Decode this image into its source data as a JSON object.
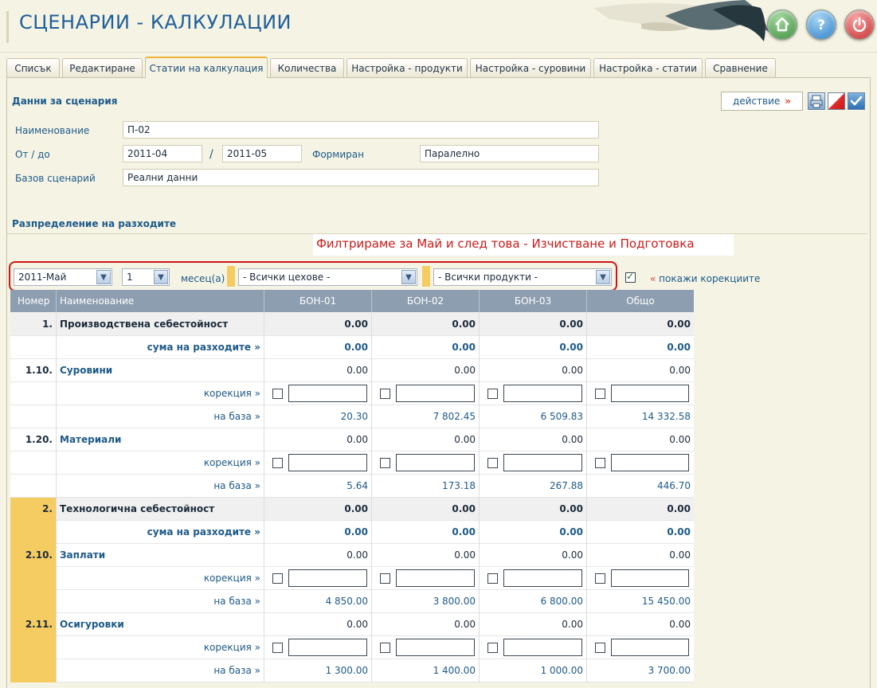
{
  "header": {
    "title": "СЦЕНАРИИ - КАЛКУЛАЦИИ",
    "buttons": [
      "home-icon",
      "help-icon",
      "power-icon"
    ]
  },
  "tabs": [
    {
      "label": "Списък",
      "active": false
    },
    {
      "label": "Редактиране",
      "active": false
    },
    {
      "label": "Статии на калкулация",
      "active": true
    },
    {
      "label": "Количества",
      "active": false
    },
    {
      "label": "Настройка - продукти",
      "active": false
    },
    {
      "label": "Настройка - суровини",
      "active": false
    },
    {
      "label": "Настройка - статии",
      "active": false
    },
    {
      "label": "Сравнение",
      "active": false
    }
  ],
  "scenario": {
    "section_title": "Данни за сценария",
    "action_label": "действие",
    "action_arrow": "»",
    "name_label": "Наименование",
    "name_value": "П-02",
    "period_label": "От / до",
    "from_value": "2011-04",
    "period_sep": "/",
    "to_value": "2011-05",
    "formed_label": "Формиран",
    "formed_value": "Паралелно",
    "base_label": "Базов сценарий",
    "base_value": "Реални данни"
  },
  "distribution": {
    "section_title": "Разпределение на разходите",
    "note": "Филтрираме за Май и след това - Изчистване и Подготовка",
    "month_select": "2011-Май",
    "count_select": "1",
    "months_label": "месец(а)",
    "workshop_select": "- Всички цехове -",
    "product_select": "- Всички продукти -",
    "show_corrections_arrow": "«",
    "show_corrections_label": "покажи корекциите",
    "show_corrections_checked": true
  },
  "table": {
    "headers": [
      "Номер",
      "Наименование",
      "БОН-01",
      "БОН-02",
      "БОН-03",
      "Общо"
    ],
    "rows": [
      {
        "kind": "group",
        "num": "1.",
        "name": "Производствена себестойност",
        "values": [
          "0.00",
          "0.00",
          "0.00",
          "0.00"
        ],
        "stripe": false
      },
      {
        "kind": "sum",
        "num": "",
        "name": "сума на разходите »",
        "values": [
          "0.00",
          "0.00",
          "0.00",
          "0.00"
        ],
        "stripe": false
      },
      {
        "kind": "item",
        "num": "1.10.",
        "name": "Суровини",
        "values": [
          "0.00",
          "0.00",
          "0.00",
          "0.00"
        ],
        "stripe": false
      },
      {
        "kind": "corr",
        "num": "",
        "name": "корекция »",
        "values": [],
        "stripe": false
      },
      {
        "kind": "base",
        "num": "",
        "name": "на база »",
        "values": [
          "20.30",
          "7 802.45",
          "6 509.83",
          "14 332.58"
        ],
        "stripe": false
      },
      {
        "kind": "item",
        "num": "1.20.",
        "name": "Материали",
        "values": [
          "0.00",
          "0.00",
          "0.00",
          "0.00"
        ],
        "stripe": false
      },
      {
        "kind": "corr",
        "num": "",
        "name": "корекция »",
        "values": [],
        "stripe": false
      },
      {
        "kind": "base",
        "num": "",
        "name": "на база »",
        "values": [
          "5.64",
          "173.18",
          "267.88",
          "446.70"
        ],
        "stripe": false
      },
      {
        "kind": "group",
        "num": "2.",
        "name": "Технологична себестойност",
        "values": [
          "0.00",
          "0.00",
          "0.00",
          "0.00"
        ],
        "stripe": true
      },
      {
        "kind": "sum",
        "num": "",
        "name": "сума на разходите »",
        "values": [
          "0.00",
          "0.00",
          "0.00",
          "0.00"
        ],
        "stripe": true
      },
      {
        "kind": "item",
        "num": "2.10.",
        "name": "Заплати",
        "values": [
          "0.00",
          "0.00",
          "0.00",
          "0.00"
        ],
        "stripe": true
      },
      {
        "kind": "corr",
        "num": "",
        "name": "корекция »",
        "values": [],
        "stripe": true
      },
      {
        "kind": "base",
        "num": "",
        "name": "на база »",
        "values": [
          "4 850.00",
          "3 800.00",
          "6 800.00",
          "15 450.00"
        ],
        "stripe": true
      },
      {
        "kind": "item",
        "num": "2.11.",
        "name": "Осигуровки",
        "values": [
          "0.00",
          "0.00",
          "0.00",
          "0.00"
        ],
        "stripe": true
      },
      {
        "kind": "corr",
        "num": "",
        "name": "корекция »",
        "values": [],
        "stripe": true
      },
      {
        "kind": "base",
        "num": "",
        "name": "на база »",
        "values": [
          "1 300.00",
          "1 400.00",
          "1 000.00",
          "3 700.00"
        ],
        "stripe": true
      }
    ]
  },
  "colors": {
    "title_blue": "#1f5f9a",
    "accent_yellow": "#f5cc62",
    "highlight_red": "#cc1616",
    "header_grey": "#8d9eb0"
  }
}
